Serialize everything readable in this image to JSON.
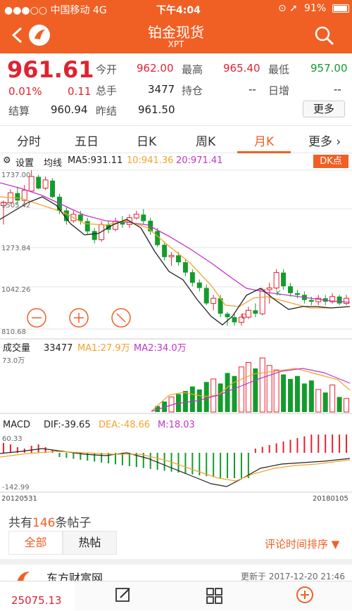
{
  "status": {
    "carrier": "●●●○○ 中国移动 4G",
    "time": "下午4:04",
    "battery": "91%"
  },
  "header": {
    "title": "铂金现货",
    "code": "XPT"
  },
  "quote": {
    "price": "961.61",
    "change_pct": "0.01%",
    "change": "0.11",
    "fields": [
      {
        "label": "今开",
        "value": "962.00"
      },
      {
        "label": "最高",
        "value": "965.40"
      },
      {
        "label": "最低",
        "value": "957.00"
      },
      {
        "label": "总手",
        "value": "3477"
      },
      {
        "label": "持仓",
        "value": "--"
      },
      {
        "label": "日增",
        "value": "--"
      },
      {
        "label": "结算",
        "value": "960.94"
      },
      {
        "label": "昨结",
        "value": "961.50"
      }
    ],
    "more": "更多"
  },
  "tabs": [
    "分时",
    "五日",
    "日K",
    "周K",
    "月K",
    "更多"
  ],
  "active_tab": "月K",
  "ma": {
    "settings": "设置",
    "label": "均线",
    "ma5": "MA5:931.11",
    "ma10": "10:941.36",
    "ma20": "20:971.41",
    "dk": "DK点"
  },
  "kline": {
    "y_labels": [
      "1737.00",
      "1505.42",
      "1273.84",
      "1042.26",
      "810.68"
    ],
    "marks": {
      "D": "D",
      "K": "K"
    }
  },
  "volume": {
    "label": "成交量",
    "value": "33477",
    "ma1": "MA1:27.9万",
    "ma2": "MA2:34.0万",
    "max": "73.0万"
  },
  "macd": {
    "label": "MACD",
    "dif": "DIF:-39.65",
    "dea": "DEA:-48.66",
    "m": "M:18.03",
    "max": "60.33",
    "min": "-142.99",
    "date_start": "20120531",
    "date_end": "20180105"
  },
  "posts": {
    "prefix": "共有",
    "count": "146",
    "suffix": "条帖子",
    "tabs": [
      "全部",
      "热帖"
    ],
    "sort": "评论时间排序 ▼",
    "source": "东方财富网",
    "updated": "更新于 2017-12-20 21:46"
  },
  "bottom": {
    "index": "25075.13"
  },
  "colors": {
    "accent": "#f06024",
    "up": "#e0232f",
    "down": "#139c2c",
    "ma5": "#222222",
    "ma10": "#f3a32a",
    "ma20": "#c035c6"
  },
  "chart_data": {
    "type": "candlestick",
    "candles": [
      [
        1530,
        1550,
        1420,
        1560,
        1420
      ],
      [
        1548,
        1605,
        1540,
        1625,
        1520
      ],
      [
        1603,
        1560,
        1540,
        1640,
        1530
      ],
      [
        1560,
        1620,
        1545,
        1650,
        1545
      ],
      [
        1615,
        1700,
        1610,
        1737,
        1605
      ],
      [
        1698,
        1630,
        1625,
        1710,
        1610
      ],
      [
        1632,
        1680,
        1620,
        1700,
        1610
      ],
      [
        1676,
        1580,
        1575,
        1690,
        1560
      ],
      [
        1582,
        1500,
        1480,
        1600,
        1470
      ],
      [
        1502,
        1440,
        1420,
        1520,
        1400
      ],
      [
        1442,
        1480,
        1430,
        1500,
        1420
      ],
      [
        1478,
        1440,
        1420,
        1500,
        1400
      ],
      [
        1440,
        1380,
        1360,
        1460,
        1340
      ],
      [
        1382,
        1330,
        1310,
        1400,
        1300
      ],
      [
        1332,
        1420,
        1320,
        1440,
        1300
      ],
      [
        1418,
        1390,
        1370,
        1440,
        1360
      ],
      [
        1392,
        1440,
        1380,
        1460,
        1370
      ],
      [
        1436,
        1420,
        1400,
        1470,
        1390
      ],
      [
        1420,
        1460,
        1400,
        1480,
        1390
      ],
      [
        1458,
        1480,
        1450,
        1500,
        1440
      ],
      [
        1478,
        1440,
        1420,
        1510,
        1420
      ],
      [
        1442,
        1380,
        1360,
        1460,
        1340
      ],
      [
        1382,
        1300,
        1290,
        1400,
        1270
      ],
      [
        1302,
        1230,
        1210,
        1320,
        1200
      ],
      [
        1232,
        1240,
        1180,
        1260,
        1170
      ],
      [
        1240,
        1200,
        1180,
        1260,
        1160
      ],
      [
        1200,
        1140,
        1120,
        1220,
        1100
      ],
      [
        1142,
        1080,
        1060,
        1160,
        1040
      ],
      [
        1082,
        1050,
        1030,
        1100,
        1010
      ],
      [
        1050,
        960,
        950,
        1070,
        930
      ],
      [
        960,
        990,
        920,
        1010,
        900
      ],
      [
        990,
        900,
        880,
        1010,
        860
      ],
      [
        900,
        880,
        830,
        910,
        820
      ],
      [
        880,
        850,
        830,
        900,
        810
      ],
      [
        850,
        880,
        830,
        900,
        820
      ],
      [
        880,
        920,
        870,
        940,
        860
      ],
      [
        920,
        900,
        880,
        960,
        870
      ],
      [
        900,
        1040,
        890,
        1050,
        880
      ],
      [
        1040,
        1050,
        960,
        1080,
        940
      ],
      [
        1050,
        1140,
        1040,
        1160,
        1030
      ],
      [
        1140,
        1060,
        1040,
        1160,
        1030
      ],
      [
        1060,
        1020,
        1000,
        1080,
        990
      ],
      [
        1020,
        1010,
        990,
        1040,
        980
      ],
      [
        1010,
        980,
        960,
        1030,
        950
      ],
      [
        980,
        970,
        950,
        1000,
        940
      ],
      [
        970,
        990,
        950,
        1010,
        940
      ],
      [
        990,
        970,
        950,
        1010,
        940
      ],
      [
        970,
        1000,
        960,
        1020,
        950
      ],
      [
        1000,
        960,
        950,
        1010,
        940
      ],
      [
        960,
        990,
        950,
        1010,
        940
      ]
    ],
    "volume_ylim": [
      0,
      73
    ]
  }
}
